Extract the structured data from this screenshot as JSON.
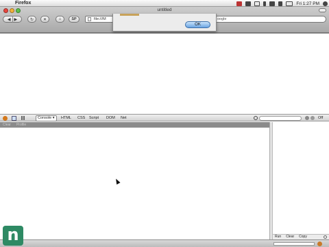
{
  "menubar": {
    "apple_glyph": "",
    "app_name": "Firefox",
    "clock": "Fri 1:27 PM"
  },
  "browser": {
    "window_title": "untitled",
    "back_glyph": "◀",
    "forward_glyph": "▶",
    "reload_glyph": "↻",
    "stop_glyph": "✕",
    "home_glyph": "⌂",
    "sp_label": "SP",
    "url": "file:///M",
    "search_text": "oogle",
    "tab_title": "untitled",
    "new_tab_glyph": "+",
    "tab_scroll_glyph": "◂"
  },
  "dialog": {
    "ok_label": "OK"
  },
  "firebug": {
    "tabs": {
      "console": "Console ▾",
      "html": "HTML",
      "css": "CSS",
      "script": "Script",
      "dom": "DOM",
      "net": "Net"
    },
    "off_label": "Off",
    "subbar": [
      "Clear",
      "Profile"
    ],
    "cmd_buttons": {
      "run": "Run",
      "clear": "Clear",
      "copy": "Copy"
    }
  },
  "overlay": {
    "logo_letter": "n",
    "logo_color": "#2e8a64"
  },
  "colors": {
    "ok_button": "#6aa4e2",
    "firebug_accent": "#d3781c"
  }
}
